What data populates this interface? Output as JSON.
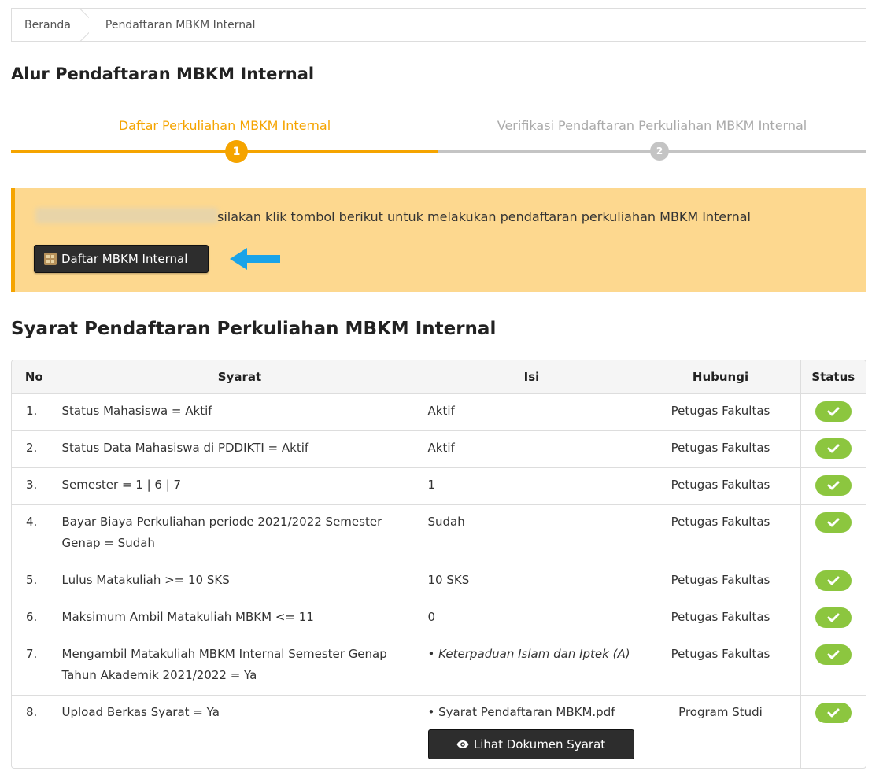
{
  "breadcrumb": {
    "home": "Beranda",
    "current": "Pendaftaran MBKM Internal"
  },
  "page_title": "Alur Pendaftaran MBKM Internal",
  "stepper": {
    "steps": [
      {
        "label": "Daftar Perkuliahan MBKM Internal",
        "number": "1",
        "state": "active"
      },
      {
        "label": "Verifikasi Pendaftaran Perkuliahan MBKM Internal",
        "number": "2",
        "state": "inactive"
      }
    ]
  },
  "alert": {
    "message": "silakan klik tombol berikut untuk melakukan pendaftaran perkuliahan MBKM Internal",
    "button_label": "Daftar MBKM Internal"
  },
  "requirements": {
    "title": "Syarat Pendaftaran Perkuliahan MBKM Internal",
    "columns": [
      "No",
      "Syarat",
      "Isi",
      "Hubungi",
      "Status"
    ],
    "rows": [
      {
        "no": "1.",
        "syarat": "Status Mahasiswa = Aktif",
        "isi": "Aktif",
        "hubungi": "Petugas Fakultas"
      },
      {
        "no": "2.",
        "syarat": "Status Data Mahasiswa di PDDIKTI = Aktif",
        "isi": "Aktif",
        "hubungi": "Petugas Fakultas"
      },
      {
        "no": "3.",
        "syarat": "Semester = 1 | 6 | 7",
        "isi": "1",
        "hubungi": "Petugas Fakultas"
      },
      {
        "no": "4.",
        "syarat": "Bayar Biaya Perkuliahan periode 2021/2022 Semester Genap = Sudah",
        "isi": "Sudah",
        "hubungi": "Petugas Fakultas"
      },
      {
        "no": "5.",
        "syarat": "Lulus Matakuliah >= 10 SKS",
        "isi": "10 SKS",
        "hubungi": "Petugas Fakultas"
      },
      {
        "no": "6.",
        "syarat": "Maksimum Ambil Matakuliah MBKM <= 11",
        "isi": "0",
        "hubungi": "Petugas Fakultas"
      },
      {
        "no": "7.",
        "syarat": "Mengambil Matakuliah MBKM Internal Semester Genap Tahun Akademik 2021/2022 = Ya",
        "isi": "• Keterpaduan Islam dan Iptek (A)",
        "hubungi": "Petugas Fakultas"
      },
      {
        "no": "8.",
        "syarat": "Upload Berkas Syarat = Ya",
        "isi": "• Syarat Pendaftaran MBKM.pdf",
        "hubungi": "Program Studi",
        "button_label": "Lihat Dokumen Syarat"
      }
    ]
  },
  "colors": {
    "accent": "#f5a400",
    "alert_bg": "#fdd88f",
    "status_ok": "#8cc63f",
    "arrow": "#1aa3e8"
  }
}
